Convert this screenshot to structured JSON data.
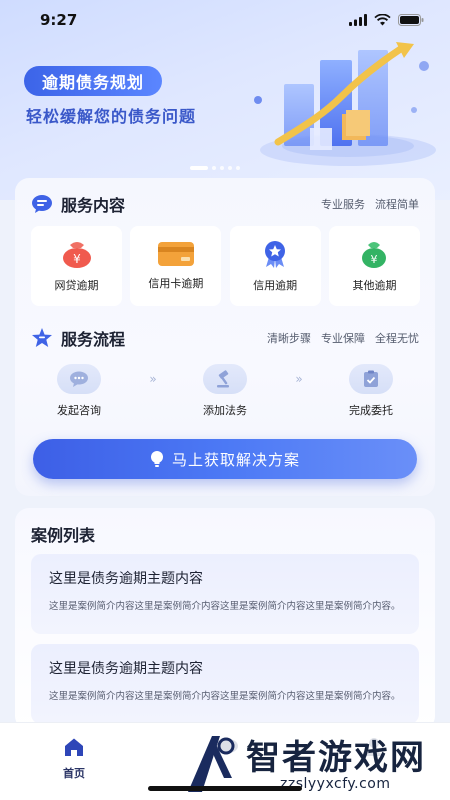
{
  "status": {
    "time": "9:27"
  },
  "hero": {
    "title": "逾期债务规划",
    "subtitle": "轻松缓解您的债务问题"
  },
  "services": {
    "title": "服务内容",
    "tags": [
      "专业服务",
      "流程简单"
    ],
    "items": [
      {
        "label": "网贷逾期",
        "icon": "money-bag-icon"
      },
      {
        "label": "信用卡逾期",
        "icon": "credit-card-icon"
      },
      {
        "label": "信用逾期",
        "icon": "medal-icon"
      },
      {
        "label": "其他逾期",
        "icon": "green-money-bag-icon"
      }
    ]
  },
  "process": {
    "title": "服务流程",
    "tags": [
      "清晰步骤",
      "专业保障",
      "全程无忧"
    ],
    "steps": [
      {
        "label": "发起咨询",
        "icon": "chat-icon"
      },
      {
        "label": "添加法务",
        "icon": "gavel-icon"
      },
      {
        "label": "完成委托",
        "icon": "clipboard-check-icon"
      }
    ]
  },
  "cta": {
    "label": "马上获取解决方案"
  },
  "cases": {
    "title": "案例列表",
    "items": [
      {
        "title": "这里是债务逾期主题内容",
        "desc": "这里是案例简介内容这里是案例简介内容这里是案例简介内容这里是案例简介内容。"
      },
      {
        "title": "这里是债务逾期主题内容",
        "desc": "这里是案例简介内容这里是案例简介内容这里是案例简介内容这里是案例简介内容。"
      }
    ]
  },
  "tabbar": {
    "home": "首页"
  },
  "watermark": {
    "title": "智者游戏网",
    "url": "zzslyyxcfy.com"
  },
  "colors": {
    "primary": "#3d5fe6",
    "accent_text": "#3a58c9",
    "page_bg": "#eef2fb"
  }
}
